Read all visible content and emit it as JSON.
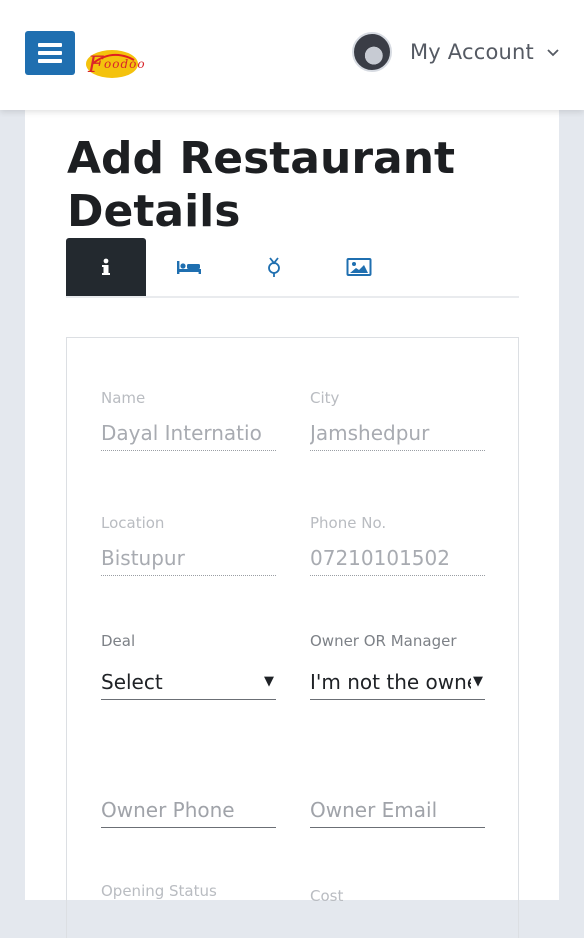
{
  "header": {
    "logo_text": "Foodoo",
    "account_label": "My Account",
    "accent": "#1f6fb0"
  },
  "page": {
    "title": "Add Restaurant Details"
  },
  "tabs": [
    {
      "name": "info",
      "icon": "info-icon",
      "active": true
    },
    {
      "name": "rooms",
      "icon": "bed-icon",
      "active": false
    },
    {
      "name": "amenities",
      "icon": "gender-icon",
      "active": false
    },
    {
      "name": "images",
      "icon": "image-icon",
      "active": false
    }
  ],
  "form": {
    "name": {
      "label": "Name",
      "value": "Dayal Internatio"
    },
    "city": {
      "label": "City",
      "value": "Jamshedpur"
    },
    "location": {
      "label": "Location",
      "value": "Bistupur"
    },
    "phone": {
      "label": "Phone No.",
      "value": "07210101502"
    },
    "deal": {
      "label": "Deal",
      "value": "Select"
    },
    "owner_or_manager": {
      "label": "Owner OR Manager",
      "value": "I'm not the owne"
    },
    "owner_phone": {
      "placeholder": "Owner Phone"
    },
    "owner_email": {
      "placeholder": "Owner Email"
    },
    "opening_status": {
      "label": "Opening Status"
    },
    "cost": {
      "label": "Cost"
    }
  }
}
